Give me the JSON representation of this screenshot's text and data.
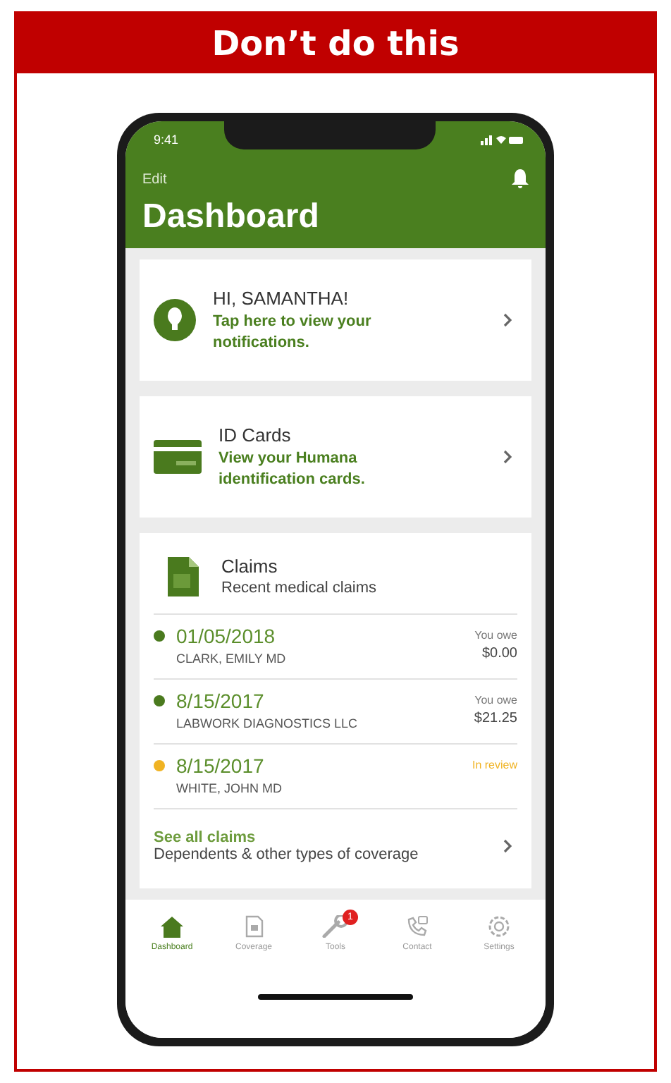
{
  "banner": {
    "title": "Don’t do this"
  },
  "status_bar": {
    "time": "9:41"
  },
  "header": {
    "edit": "Edit",
    "title": "Dashboard"
  },
  "cards": [
    {
      "kind": "person",
      "title": "HI, SAMANTHA!",
      "subtitle": "Tap here to view your notifications."
    },
    {
      "kind": "idcard",
      "title": "ID Cards",
      "subtitle": "View your Humana identification cards."
    }
  ],
  "claims": {
    "title": "Claims",
    "subtitle": "Recent medical claims",
    "rows": [
      {
        "date": "01/05/2018",
        "provider": "CLARK, EMILY MD",
        "status": "You owe",
        "amount": "$0.00",
        "color": "#4a7a1e"
      },
      {
        "date": "8/15/2017",
        "provider": "LABWORK DIAGNOSTICS LLC",
        "status": "You owe",
        "amount": "$21.25",
        "color": "#4a7a1e"
      },
      {
        "date": "8/15/2017",
        "provider": "WHITE, JOHN MD",
        "status": "In review",
        "color": "#f0b323"
      }
    ],
    "see_all": "See all claims",
    "see_all_subtitle": "Dependents & other types of coverage"
  },
  "tabs": [
    {
      "label": "Dashboard",
      "kind": "home",
      "selected": true
    },
    {
      "label": "Coverage",
      "kind": "doc",
      "selected": false
    },
    {
      "label": "Tools",
      "kind": "wrench",
      "selected": false,
      "badge": "1"
    },
    {
      "label": "Contact",
      "kind": "phone",
      "selected": false
    },
    {
      "label": "Settings",
      "kind": "gear",
      "selected": false
    }
  ]
}
